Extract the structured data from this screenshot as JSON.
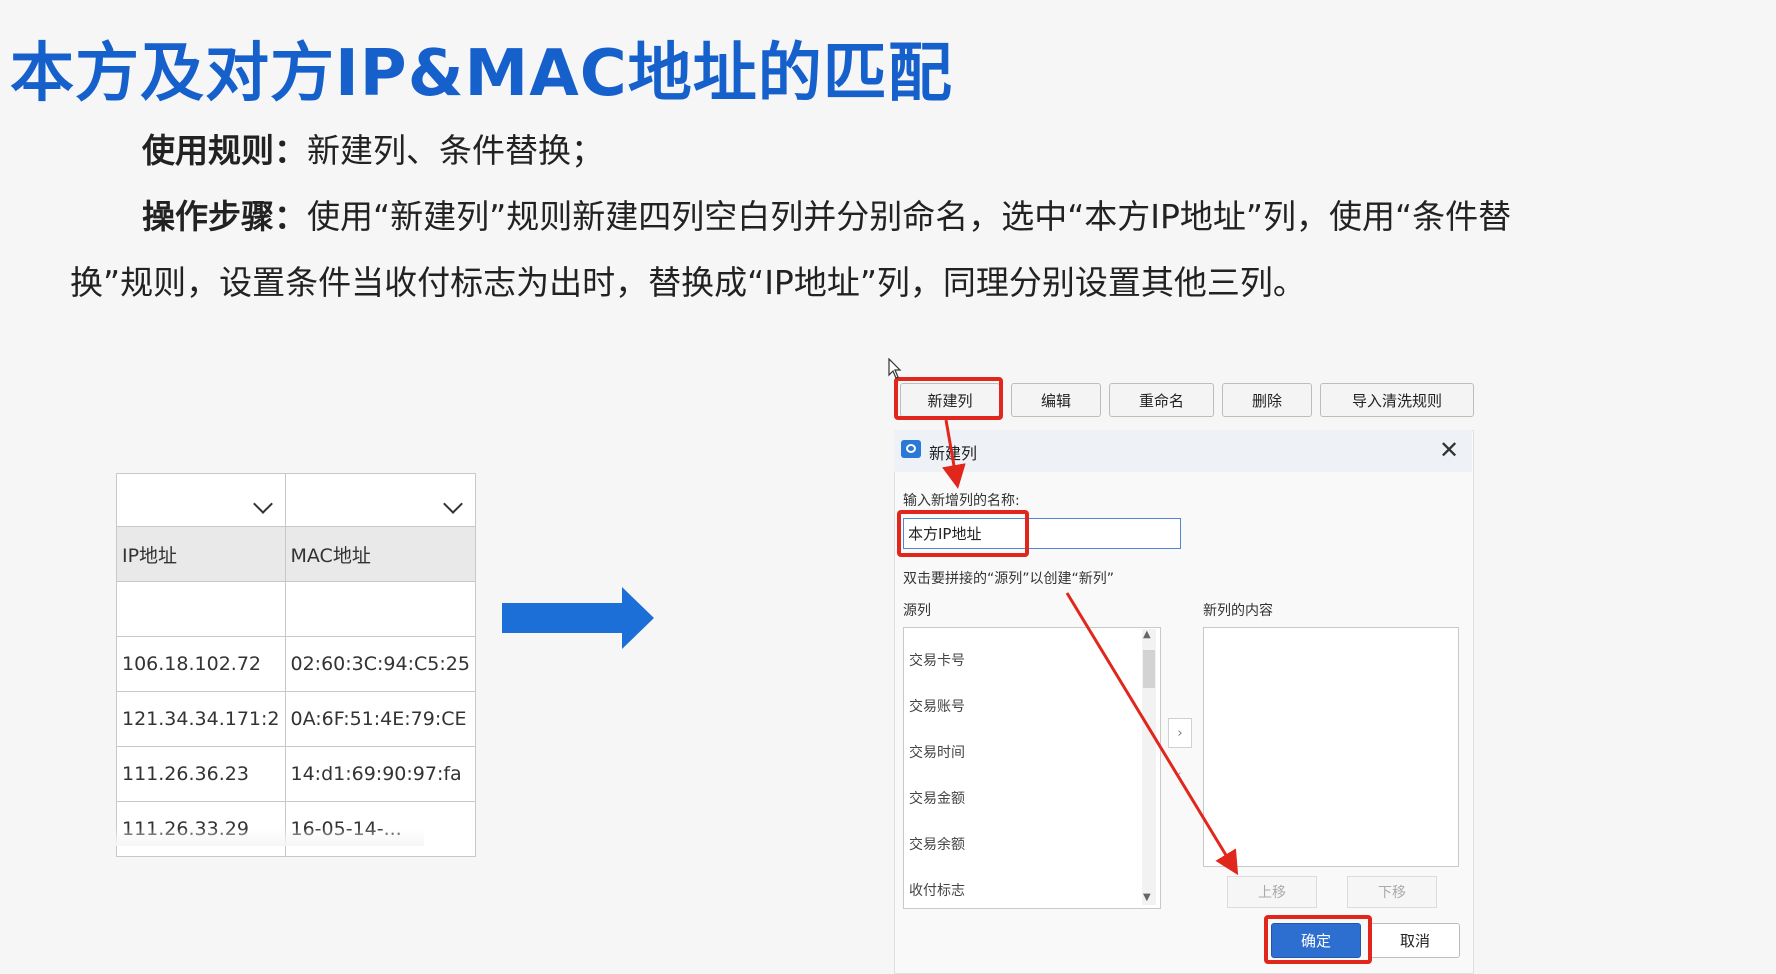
{
  "slide": {
    "title": "本方及对方IP&MAC地址的匹配",
    "rule_label": "使用规则：",
    "rule_text": "新建列、条件替换；",
    "steps_label": "操作步骤：",
    "steps_text_1": "使用“新建列”规则新建四列空白列并分别命名，选中“本方IP地址”列，使用“条件替",
    "steps_text_2": "换”规则，设置条件当收付标志为出时，替换成“IP地址”列，同理分别设置其他三列。"
  },
  "table": {
    "headers": [
      "IP地址",
      "MAC地址"
    ],
    "rows": [
      [
        "",
        ""
      ],
      [
        "106.18.102.72",
        "02:60:3C:94:C5:25"
      ],
      [
        "121.34.34.171:2",
        "0A:6F:51:4E:79:CE"
      ],
      [
        "111.26.36.23",
        "14:d1:69:90:97:fa"
      ],
      [
        "111.26.33.29",
        "16-05-14-..."
      ]
    ]
  },
  "toolbar": {
    "new_column": "新建列",
    "edit": "编辑",
    "rename": "重命名",
    "delete": "删除",
    "import_rules": "导入清洗规则"
  },
  "dialog": {
    "title": "新建列",
    "close_glyph": "✕",
    "name_label": "输入新增列的名称:",
    "name_value": "本方IP地址",
    "hint": "双击要拼接的“源列”以创建“新列”",
    "source_label": "源列",
    "new_content_label": "新列的内容",
    "source_items": [
      "交易卡号",
      "交易账号",
      "交易时间",
      "交易金额",
      "交易余额",
      "收付标志"
    ],
    "move_right_glyph": "›",
    "move_left_glyph": "‹",
    "up": "上移",
    "down": "下移",
    "ok": "确定",
    "cancel": "取消"
  },
  "colors": {
    "title_blue": "#1660cc",
    "arrow_blue": "#1b6fd6",
    "highlight_red": "#e1261c",
    "ok_button": "#2d6fd0"
  },
  "icons": [
    "chevron-down-icon",
    "right-arrow-icon",
    "app-icon",
    "close-icon",
    "cursor-icon",
    "chevron-right-icon",
    "chevron-left-icon"
  ]
}
